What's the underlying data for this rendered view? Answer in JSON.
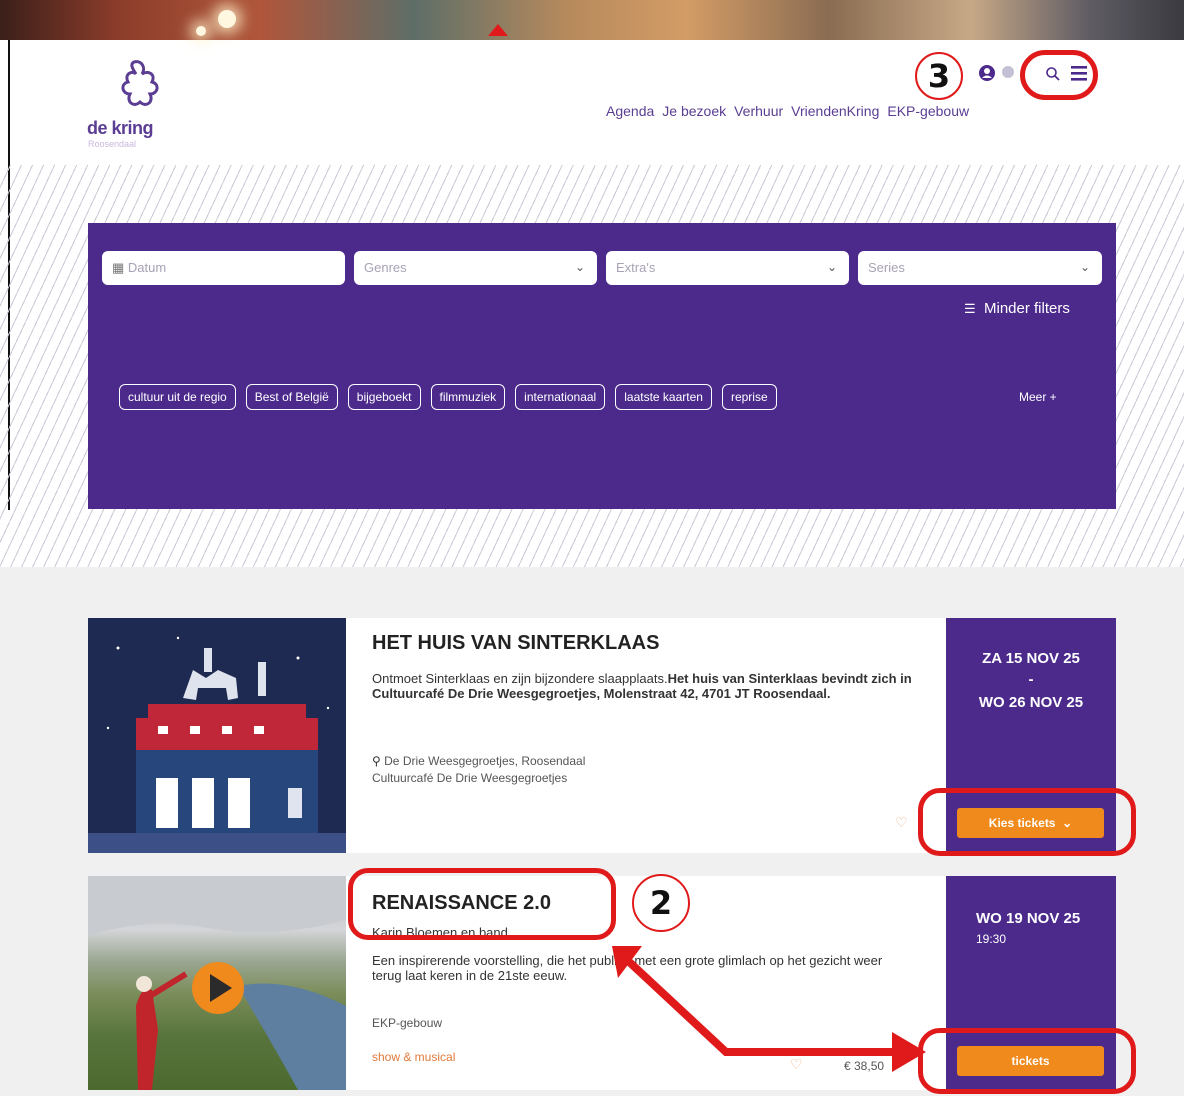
{
  "header": {
    "logo_name": "de kring",
    "logo_sub": "Roosendaal",
    "nav": [
      "Agenda",
      "Je bezoek",
      "Verhuur",
      "VriendenKring",
      "EKP-gebouw"
    ]
  },
  "filters": {
    "date_placeholder": "Datum",
    "genres_placeholder": "Genres",
    "extras_placeholder": "Extra's",
    "series_placeholder": "Series",
    "less_filters": "Minder filters",
    "tags": [
      "cultuur uit de regio",
      "Best of België",
      "bijgeboekt",
      "filmmuziek",
      "internationaal",
      "laatste kaarten",
      "reprise"
    ],
    "more": "Meer +"
  },
  "events": [
    {
      "title": "HET HUIS VAN SINTERKLAAS",
      "desc_plain": "Ontmoet Sinterklaas en zijn bijzondere slaapplaats.",
      "desc_bold": "Het huis van Sinterklaas bevindt zich in Cultuurcafé De Drie Weesgegroetjes, Molenstraat 42, 4701 JT Roosendaal.",
      "location": "De Drie Weesgegroetjes, Roosendaal",
      "venue": "Cultuurcafé De Drie Weesgegroetjes",
      "date_start": "ZA 15 NOV 25",
      "date_sep": "-",
      "date_end": "WO 26 NOV 25",
      "button": "Kies tickets"
    },
    {
      "title": "RENAISSANCE 2.0",
      "subtitle": "Karin Bloemen en band",
      "desc": "Een inspirerende voorstelling, die het publiek met een grote glimlach op het gezicht weer terug laat keren in de 21ste eeuw.",
      "venue": "EKP-gebouw",
      "category": "show & musical",
      "price": "€ 38,50",
      "date": "WO 19 NOV 25",
      "time": "19:30",
      "button": "tickets"
    }
  ],
  "annotations": {
    "two": "2",
    "three": "3"
  },
  "colors": {
    "purple": "#4b2a8c",
    "orange": "#f08a1c",
    "annotation_red": "#e01a1a"
  }
}
